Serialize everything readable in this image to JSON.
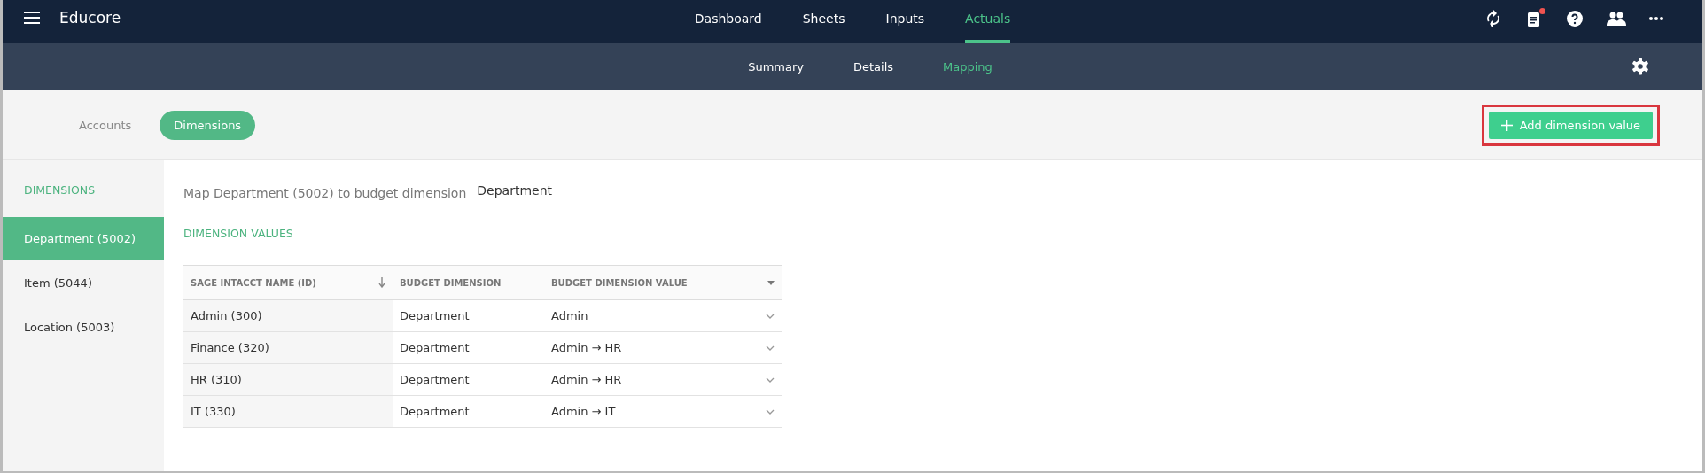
{
  "app": {
    "title": "Educore"
  },
  "main_nav": [
    {
      "label": "Dashboard",
      "selected": false
    },
    {
      "label": "Sheets",
      "selected": false
    },
    {
      "label": "Inputs",
      "selected": false
    },
    {
      "label": "Actuals",
      "selected": true
    }
  ],
  "header_icons": [
    {
      "kind": "sync"
    },
    {
      "kind": "clipboard",
      "badge": true
    },
    {
      "kind": "help"
    },
    {
      "kind": "people"
    },
    {
      "kind": "more"
    }
  ],
  "sub_nav": [
    {
      "label": "Summary",
      "selected": false
    },
    {
      "label": "Details",
      "selected": false
    },
    {
      "label": "Mapping",
      "selected": true
    }
  ],
  "toggle": [
    {
      "label": "Accounts",
      "selected": false
    },
    {
      "label": "Dimensions",
      "selected": true
    }
  ],
  "add_button": {
    "label": "Add dimension value",
    "highlighted": true
  },
  "sidebar": {
    "heading": "DIMENSIONS",
    "items": [
      {
        "label": "Department (5002)",
        "selected": true
      },
      {
        "label": "Item (5044)",
        "selected": false
      },
      {
        "label": "Location (5003)",
        "selected": false
      }
    ]
  },
  "mapping": {
    "label": "Map Department (5002) to budget dimension",
    "value": "Department"
  },
  "values_heading": "DIMENSION VALUES",
  "table": {
    "columns": [
      "SAGE INTACCT NAME (ID)",
      "BUDGET DIMENSION",
      "BUDGET DIMENSION VALUE"
    ],
    "rows": [
      [
        "Admin (300)",
        "Department",
        "Admin"
      ],
      [
        "Finance (320)",
        "Department",
        "Admin → HR"
      ],
      [
        "HR (310)",
        "Department",
        "Admin → HR"
      ],
      [
        "IT (330)",
        "Department",
        "Admin → IT"
      ]
    ]
  }
}
